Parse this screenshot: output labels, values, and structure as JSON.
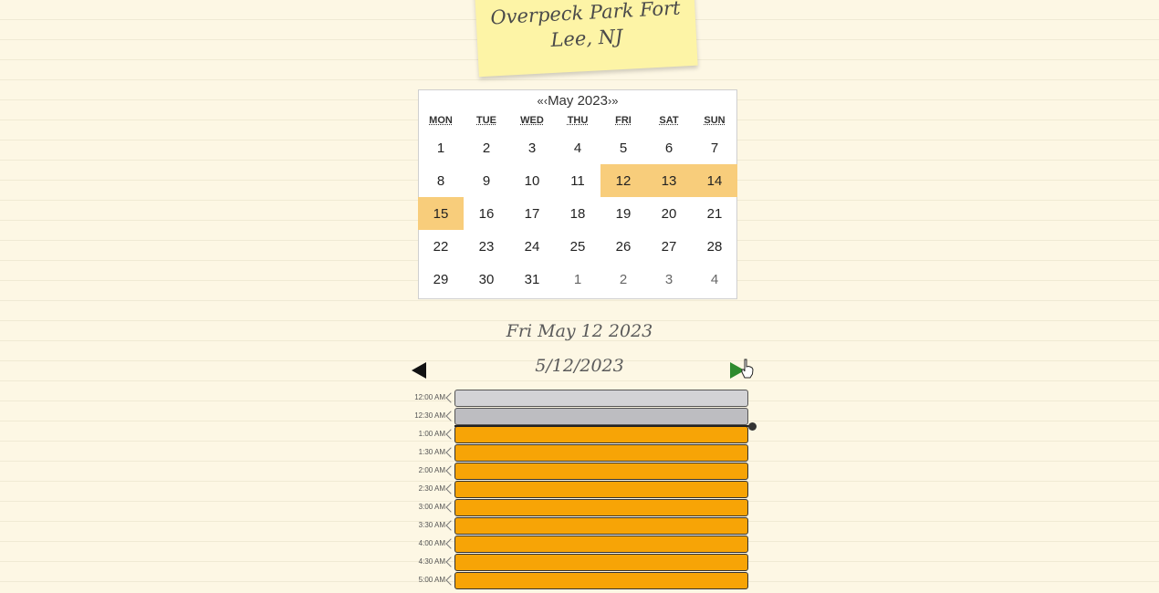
{
  "location": {
    "line1": "Overpeck Park Fort",
    "line2": "Lee, NJ"
  },
  "calendar": {
    "prev_label": "«",
    "prev_label2": "‹",
    "month_label": "May 2023",
    "next_label": "›",
    "next_label2": "»",
    "weekdays": [
      "MON",
      "TUE",
      "WED",
      "THU",
      "FRI",
      "SAT",
      "SUN"
    ],
    "weeks": [
      [
        {
          "day": "1"
        },
        {
          "day": "2"
        },
        {
          "day": "3"
        },
        {
          "day": "4"
        },
        {
          "day": "5"
        },
        {
          "day": "6"
        },
        {
          "day": "7"
        }
      ],
      [
        {
          "day": "8"
        },
        {
          "day": "9"
        },
        {
          "day": "10"
        },
        {
          "day": "11"
        },
        {
          "day": "12",
          "highlight": true
        },
        {
          "day": "13",
          "highlight": true
        },
        {
          "day": "14",
          "highlight": true
        }
      ],
      [
        {
          "day": "15",
          "highlight": true
        },
        {
          "day": "16"
        },
        {
          "day": "17"
        },
        {
          "day": "18"
        },
        {
          "day": "19"
        },
        {
          "day": "20"
        },
        {
          "day": "21"
        }
      ],
      [
        {
          "day": "22"
        },
        {
          "day": "23"
        },
        {
          "day": "24"
        },
        {
          "day": "25"
        },
        {
          "day": "26"
        },
        {
          "day": "27"
        },
        {
          "day": "28"
        }
      ],
      [
        {
          "day": "29"
        },
        {
          "day": "30"
        },
        {
          "day": "31"
        },
        {
          "day": "1",
          "neighbor": true
        },
        {
          "day": "2",
          "neighbor": true
        },
        {
          "day": "3",
          "neighbor": true
        },
        {
          "day": "4",
          "neighbor": true
        }
      ]
    ],
    "highlight_color": "#f8cd7b"
  },
  "selected_date_long": "Fri May 12 2023",
  "selected_date_short": "5/12/2023",
  "nav": {
    "prev_icon": "triangle-left-icon",
    "next_icon": "triangle-right-icon",
    "next_color": "#2e8b2e"
  },
  "time_slots": [
    {
      "time": "12:00 AM",
      "state": "past"
    },
    {
      "time": "12:30 AM",
      "state": "past-dark"
    },
    {
      "time": "1:00 AM",
      "state": "available"
    },
    {
      "time": "1:30 AM",
      "state": "available"
    },
    {
      "time": "2:00 AM",
      "state": "available"
    },
    {
      "time": "2:30 AM",
      "state": "available"
    },
    {
      "time": "3:00 AM",
      "state": "available"
    },
    {
      "time": "3:30 AM",
      "state": "available"
    },
    {
      "time": "4:00 AM",
      "state": "available"
    },
    {
      "time": "4:30 AM",
      "state": "available"
    },
    {
      "time": "5:00 AM",
      "state": "available"
    }
  ],
  "colors": {
    "available": "#f7a406",
    "past": "#d3d3d6",
    "background": "#fdf7e4",
    "sticky_note": "#fdf4a6"
  }
}
